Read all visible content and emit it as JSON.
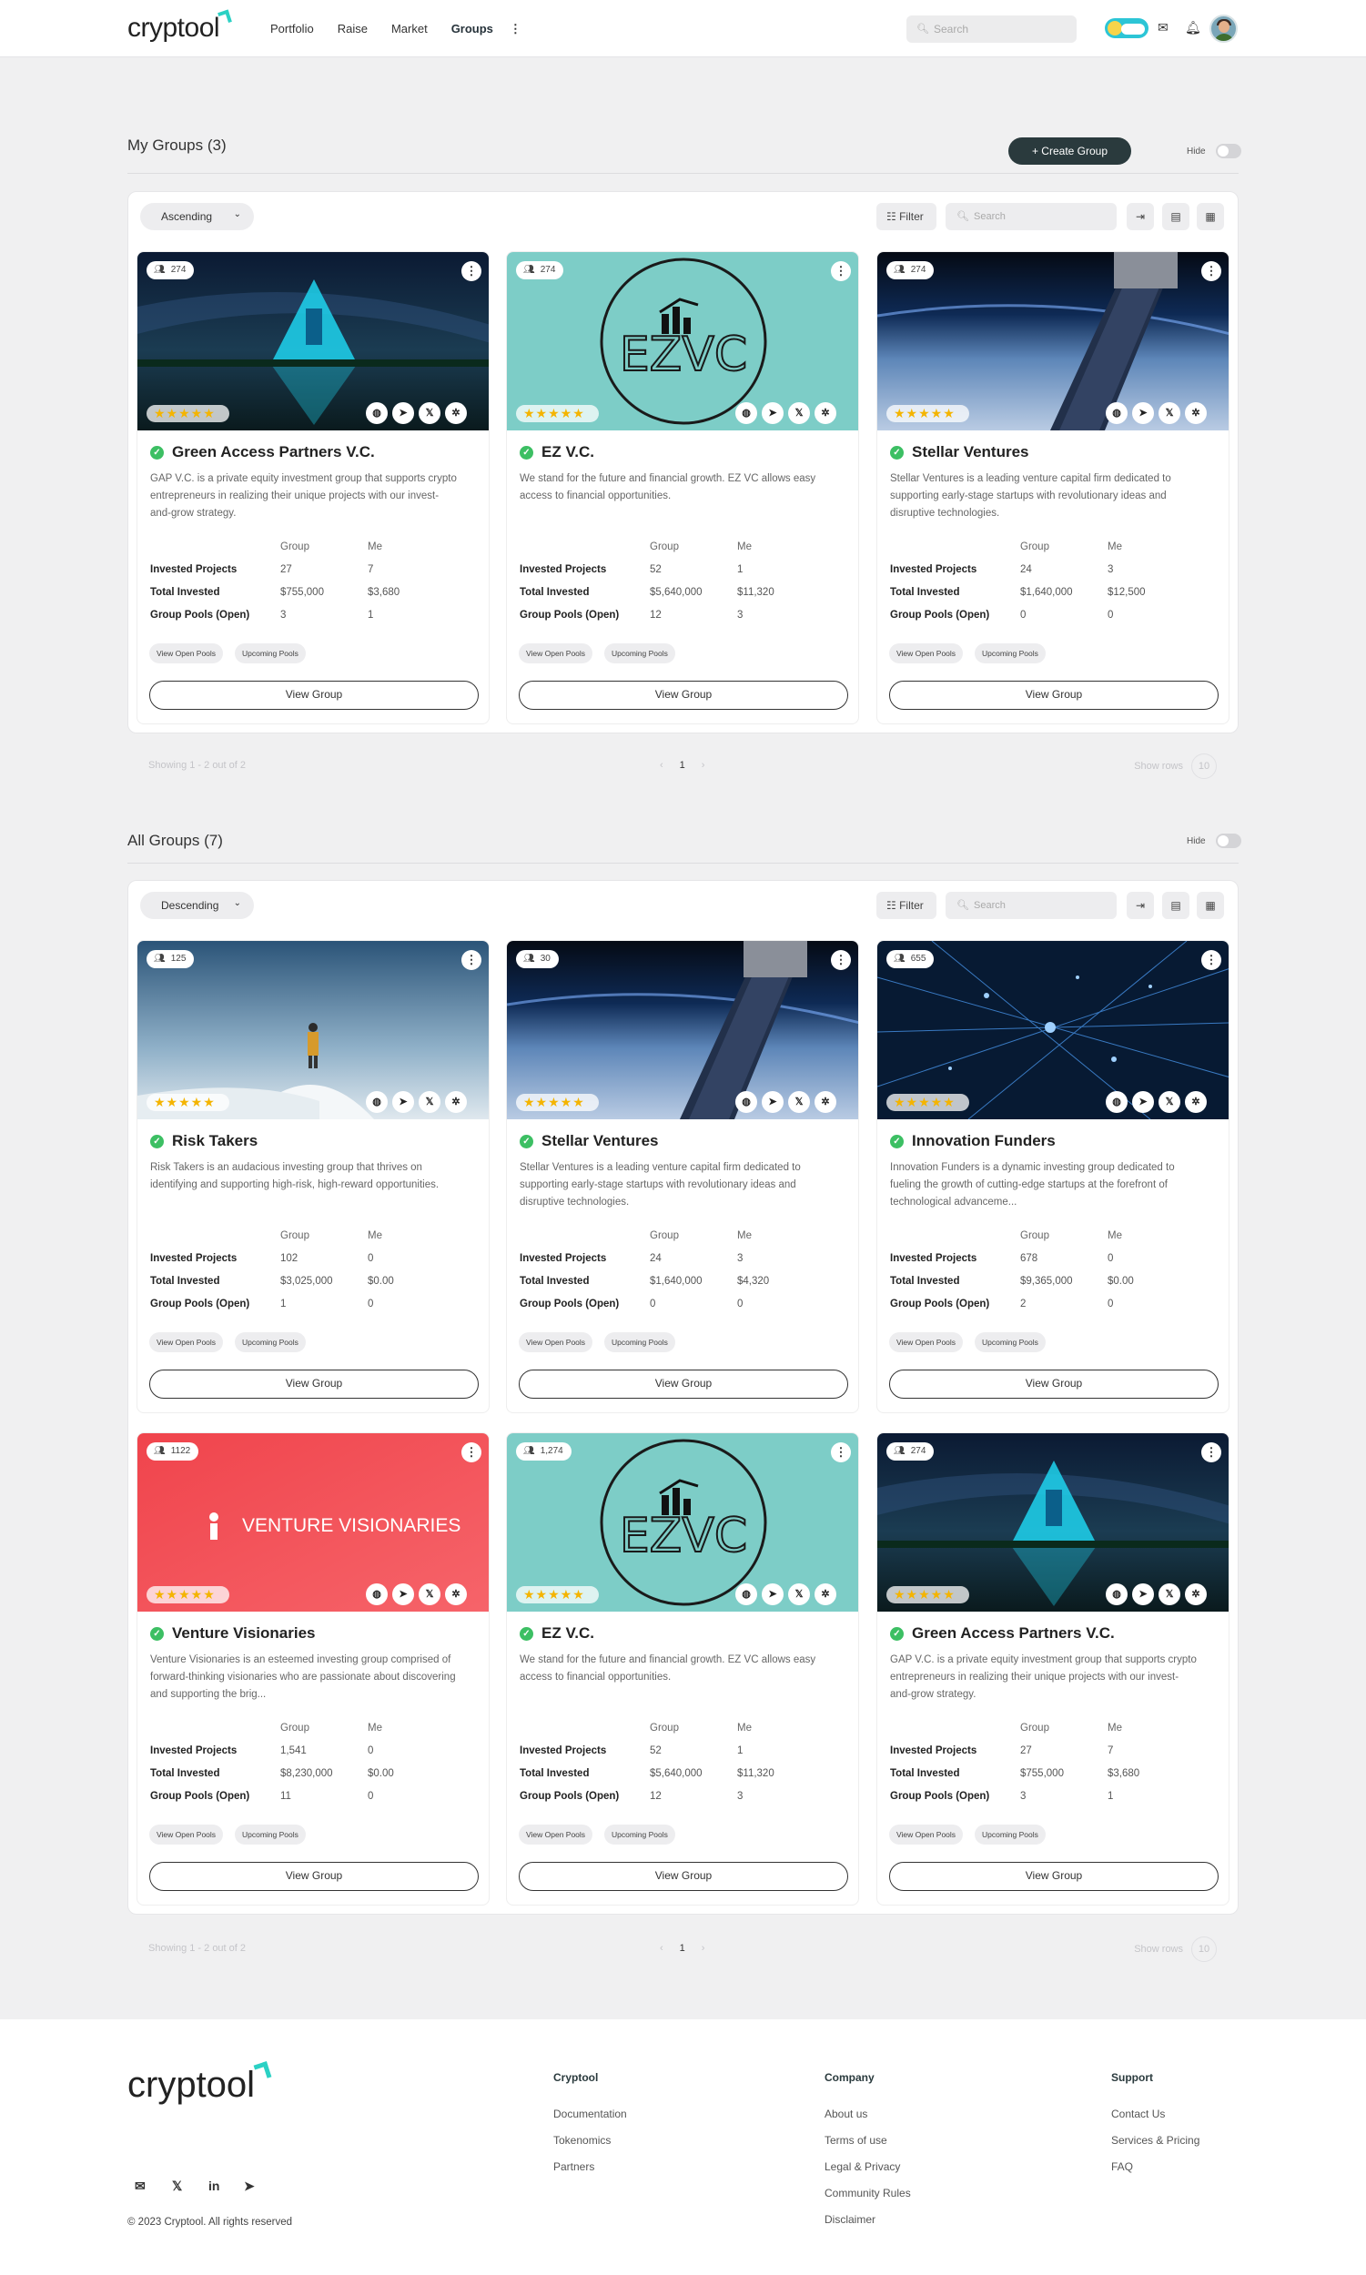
{
  "header": {
    "logo": "cryptool",
    "nav": [
      "Portfolio",
      "Raise",
      "Market",
      "Groups"
    ],
    "active_nav": "Groups",
    "more_icon": "more-vertical-icon",
    "search_placeholder": "Search"
  },
  "my_groups": {
    "title": "My Groups (3)",
    "create_label": "+ Create Group",
    "hide_label": "Hide",
    "sort_label": "Ascending",
    "filter_label": "Filter",
    "search_placeholder": "Search",
    "pagination": {
      "showing": "Showing 1 - 2 out of 2",
      "page": "1",
      "show_rows_label": "Show rows",
      "rows": "10"
    },
    "cards": [
      {
        "name": "Green Access Partners V.C.",
        "members": "274",
        "desc": "GAP V.C. is a private equity investment group that supports crypto entrepreneurs in realizing their unique projects with our invest-and-grow strategy.",
        "rating": 5,
        "stats": {
          "invested_projects": [
            "27",
            "7"
          ],
          "total_invested": [
            "$755,000",
            "$3,680"
          ],
          "group_pools": [
            "3",
            "1"
          ]
        }
      },
      {
        "name": "EZ V.C.",
        "members": "274",
        "desc": "We stand for the future and financial growth. EZ VC allows easy access to financial opportunities.",
        "rating": 5,
        "stats": {
          "invested_projects": [
            "52",
            "1"
          ],
          "total_invested": [
            "$5,640,000",
            "$11,320"
          ],
          "group_pools": [
            "12",
            "3"
          ]
        }
      },
      {
        "name": "Stellar Ventures",
        "members": "274",
        "desc": "Stellar Ventures is a leading venture capital firm dedicated to supporting early-stage startups with revolutionary ideas and disruptive technologies.",
        "rating": 5,
        "stats": {
          "invested_projects": [
            "24",
            "3"
          ],
          "total_invested": [
            "$1,640,000",
            "$12,500"
          ],
          "group_pools": [
            "0",
            "0"
          ]
        }
      }
    ]
  },
  "all_groups": {
    "title": "All Groups (7)",
    "hide_label": "Hide",
    "sort_label": "Descending",
    "filter_label": "Filter",
    "search_placeholder": "Search",
    "pagination": {
      "showing": "Showing 1 - 2 out of 2",
      "page": "1",
      "show_rows_label": "Show rows",
      "rows": "10"
    },
    "cards": [
      {
        "name": "Risk Takers",
        "members": "125",
        "desc": "Risk Takers is an audacious investing group that thrives on identifying and supporting high-risk, high-reward opportunities.",
        "rating": 5,
        "stats": {
          "invested_projects": [
            "102",
            "0"
          ],
          "total_invested": [
            "$3,025,000",
            "$0.00"
          ],
          "group_pools": [
            "1",
            "0"
          ]
        }
      },
      {
        "name": "Stellar Ventures",
        "members": "30",
        "desc": "Stellar Ventures is a leading venture capital firm dedicated to supporting early-stage startups with revolutionary ideas and disruptive technologies.",
        "rating": 5,
        "stats": {
          "invested_projects": [
            "24",
            "3"
          ],
          "total_invested": [
            "$1,640,000",
            "$4,320"
          ],
          "group_pools": [
            "0",
            "0"
          ]
        }
      },
      {
        "name": "Innovation Funders",
        "members": "655",
        "desc": "Innovation Funders is a dynamic investing group dedicated to fueling the growth of cutting-edge startups at the forefront of technological advanceme...",
        "rating": 5,
        "stats": {
          "invested_projects": [
            "678",
            "0"
          ],
          "total_invested": [
            "$9,365,000",
            "$0.00"
          ],
          "group_pools": [
            "2",
            "0"
          ]
        }
      },
      {
        "name": "Venture Visionaries",
        "members": "1122",
        "desc": "Venture Visionaries is an esteemed investing group comprised of forward-thinking visionaries who are passionate about discovering and supporting the brig...",
        "rating": 5,
        "stats": {
          "invested_projects": [
            "1,541",
            "0"
          ],
          "total_invested": [
            "$8,230,000",
            "$0.00"
          ],
          "group_pools": [
            "11",
            "0"
          ]
        }
      },
      {
        "name": "EZ V.C.",
        "members": "1,274",
        "desc": "We stand for the future and financial growth. EZ VC allows easy access to financial opportunities.",
        "rating": 5,
        "stats": {
          "invested_projects": [
            "52",
            "1"
          ],
          "total_invested": [
            "$5,640,000",
            "$11,320"
          ],
          "group_pools": [
            "12",
            "3"
          ]
        }
      },
      {
        "name": "Green Access Partners V.C.",
        "members": "274",
        "desc": "GAP V.C. is a private equity investment group that supports crypto entrepreneurs in realizing their unique projects with our invest-and-grow strategy.",
        "rating": 5,
        "stats": {
          "invested_projects": [
            "27",
            "7"
          ],
          "total_invested": [
            "$755,000",
            "$3,680"
          ],
          "group_pools": [
            "3",
            "1"
          ]
        }
      }
    ]
  },
  "card_labels": {
    "group_col": "Group",
    "me_col": "Me",
    "invested_projects": "Invested Projects",
    "total_invested": "Total Invested",
    "group_pools": "Group Pools (Open)",
    "open_pools_chip": "View Open Pools",
    "upcoming_pools_chip": "Upcoming Pools",
    "view_group": "View Group"
  },
  "image_text": {
    "ezvc_logo": "EZVC",
    "venture_visionaries_logo": "VENTURE VISIONARIES"
  },
  "footer": {
    "logo": "cryptool",
    "columns": [
      {
        "heading": "Cryptool",
        "links": [
          "Documentation",
          "Tokenomics",
          "Partners"
        ]
      },
      {
        "heading": "Company",
        "links": [
          "About us",
          "Terms of use",
          "Legal & Privacy",
          "Community Rules",
          "Disclaimer"
        ]
      },
      {
        "heading": "Support",
        "links": [
          "Contact Us",
          "Services & Pricing",
          "FAQ"
        ]
      }
    ],
    "social_icons": [
      "mail-icon",
      "x-icon",
      "linkedin-icon",
      "telegram-icon"
    ],
    "copyright": "© 2023 Cryptool. All rights reserved"
  },
  "colors": {
    "accent": "#2bd1c4",
    "dark_button": "#2a3a3d",
    "star": "#f4b400",
    "verified": "#3cbf63",
    "ezvc_bg": "#7dcdc7",
    "vv_bg": "#f0444c"
  }
}
